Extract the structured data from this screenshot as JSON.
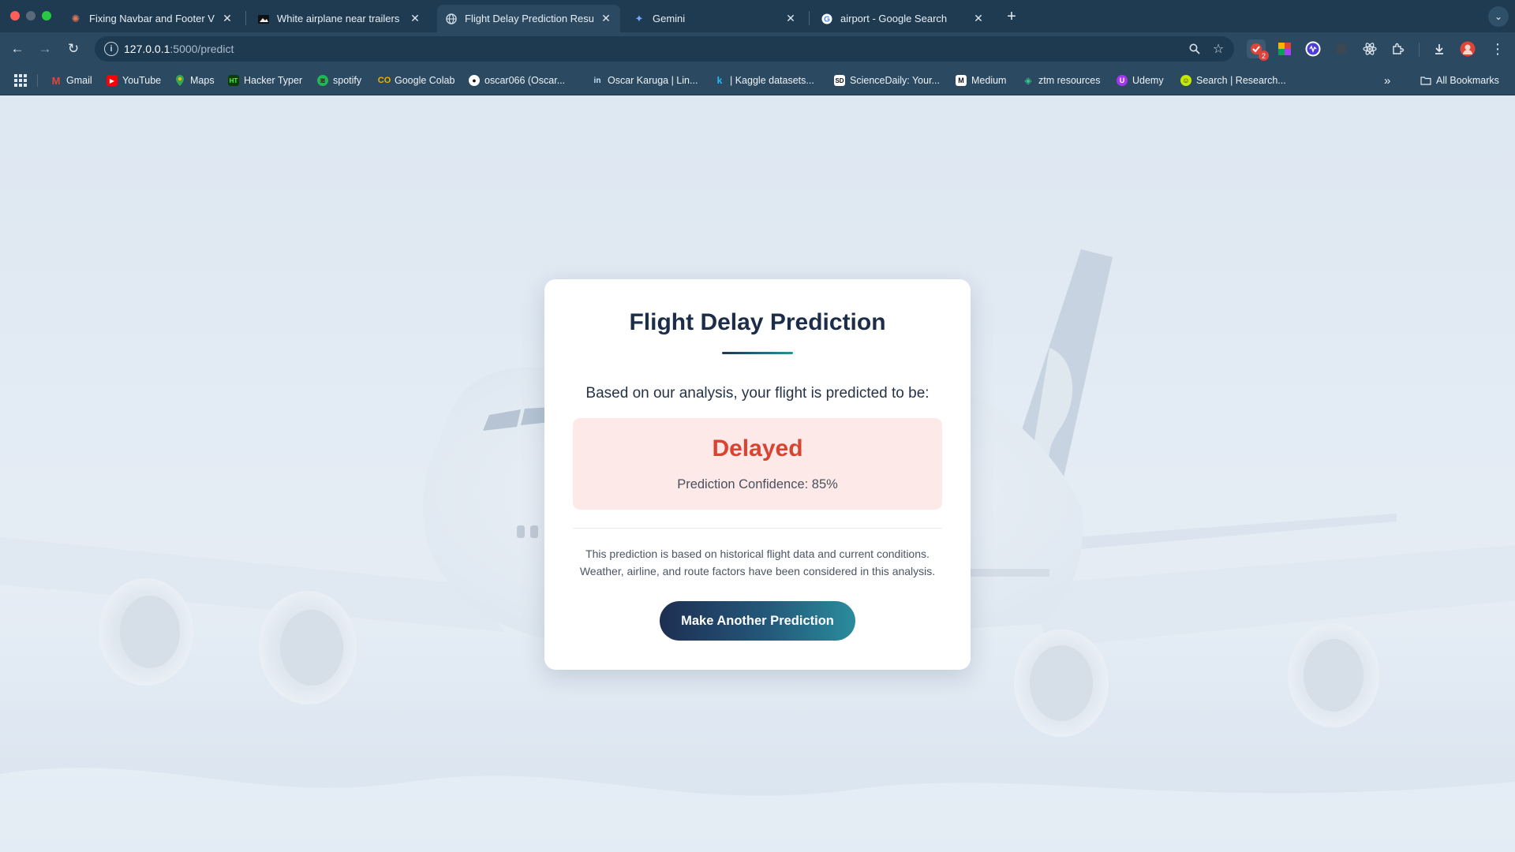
{
  "browser": {
    "tabs": [
      {
        "title": "Fixing Navbar and Footer Visi",
        "icon": "claude-burst-icon",
        "active": false
      },
      {
        "title": "White airplane near trailers d",
        "icon": "image-site-icon",
        "active": false
      },
      {
        "title": "Flight Delay Prediction Result",
        "icon": "globe-icon",
        "active": true
      },
      {
        "title": "Gemini",
        "icon": "gemini-sparkle-icon",
        "active": false
      },
      {
        "title": "airport - Google Search",
        "icon": "google-g-icon",
        "active": false
      }
    ],
    "url_host": "127.0.0.1",
    "url_path": ":5000/predict",
    "extension_badge": "2",
    "bookmarks": [
      {
        "label": "Gmail",
        "icon": "gmail-icon"
      },
      {
        "label": "YouTube",
        "icon": "youtube-icon"
      },
      {
        "label": "Maps",
        "icon": "maps-pin-icon"
      },
      {
        "label": "Hacker Typer",
        "icon": "hacker-typer-icon"
      },
      {
        "label": "spotify",
        "icon": "spotify-icon"
      },
      {
        "label": "Google Colab",
        "icon": "colab-icon"
      },
      {
        "label": "oscar066 (Oscar...",
        "icon": "github-icon"
      },
      {
        "label": "Oscar Karuga | Lin...",
        "icon": "linkedin-icon"
      },
      {
        "label": "| Kaggle datasets...",
        "icon": "kaggle-icon"
      },
      {
        "label": "ScienceDaily: Your...",
        "icon": "sciencedaily-icon"
      },
      {
        "label": "Medium",
        "icon": "medium-icon"
      },
      {
        "label": "ztm resources",
        "icon": "ztm-icon"
      },
      {
        "label": "Udemy",
        "icon": "udemy-icon"
      },
      {
        "label": "Search | Research...",
        "icon": "research-icon"
      }
    ],
    "all_bookmarks": "All Bookmarks"
  },
  "card": {
    "title": "Flight Delay Prediction",
    "subtitle": "Based on our analysis, your flight is predicted to be:",
    "result": "Delayed",
    "confidence": "Prediction Confidence: 85%",
    "note_line1": "This prediction is based on historical flight data and current conditions.",
    "note_line2": "Weather, airline, and route factors have been considered in this analysis.",
    "button": "Make Another Prediction"
  },
  "colors": {
    "result_text": "#d9432f",
    "result_bg": "#fdeae8",
    "title_text": "#1c2d4a",
    "button_start": "#1d2f52",
    "button_end": "#2a8c9c"
  }
}
